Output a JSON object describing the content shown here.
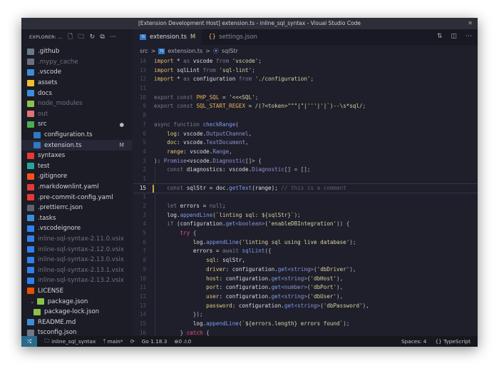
{
  "window": {
    "title": "[Extension Development Host] extension.ts - inline_sql_syntax - Visual Studio Code",
    "close": "✕"
  },
  "sidebar": {
    "header": "EXPLORER: ...",
    "items": [
      {
        "label": ".github",
        "color": "#6b7a8a",
        "dim": false
      },
      {
        "label": ".mypy_cache",
        "color": "#6b7080",
        "dim": true
      },
      {
        "label": ".vscode",
        "color": "#3b8fd9",
        "dim": false
      },
      {
        "label": "assets",
        "color": "#f0c030",
        "dim": false
      },
      {
        "label": "docs",
        "color": "#3b8fd9",
        "dim": false
      },
      {
        "label": "node_modules",
        "color": "#8bc34a",
        "dim": true
      },
      {
        "label": "out",
        "color": "#e57373",
        "dim": true
      },
      {
        "label": "src",
        "color": "#4caf50",
        "dim": false,
        "badge": "●"
      },
      {
        "label": "configuration.ts",
        "color": "#3178c6",
        "dim": false,
        "indent": 1
      },
      {
        "label": "extension.ts",
        "color": "#3178c6",
        "dim": false,
        "indent": 1,
        "badge": "M",
        "selected": true
      },
      {
        "label": "syntaxes",
        "color": "#e53935",
        "dim": false
      },
      {
        "label": "test",
        "color": "#26a69a",
        "dim": false
      },
      {
        "label": ".gitignore",
        "color": "#f4511e",
        "dim": false
      },
      {
        "label": ".markdownlint.yaml",
        "color": "#e53935",
        "dim": false
      },
      {
        "label": ".pre-commit-config.yaml",
        "color": "#e53935",
        "dim": false
      },
      {
        "label": ".prettierrc.json",
        "color": "#5c6370",
        "dim": false
      },
      {
        "label": ".tasks",
        "color": "#3b8fd9",
        "dim": false
      },
      {
        "label": ".vscodeignore",
        "color": "#2f80ed",
        "dim": false
      },
      {
        "label": "inline-sql-syntax-2.11.0.vsix",
        "color": "#2f80ed",
        "dim": true
      },
      {
        "label": "inline-sql-syntax-2.12.0.vsix",
        "color": "#2f80ed",
        "dim": true
      },
      {
        "label": "inline-sql-syntax-2.13.0.vsix",
        "color": "#2f80ed",
        "dim": true
      },
      {
        "label": "inline-sql-syntax-2.13.1.vsix",
        "color": "#2f80ed",
        "dim": true
      },
      {
        "label": "inline-sql-syntax-2.13.2.vsix",
        "color": "#2f80ed",
        "dim": true
      },
      {
        "label": "LICENSE",
        "color": "#e65100",
        "dim": false
      },
      {
        "label": "package.json",
        "color": "#8bc34a",
        "dim": false,
        "indent": 1,
        "chevron": "⌄"
      },
      {
        "label": "package-lock.json",
        "color": "#8bc34a",
        "dim": false,
        "indent": 1
      },
      {
        "label": "README.md",
        "color": "#3b8fd9",
        "dim": false
      },
      {
        "label": "tsconfig.json",
        "color": "#6b7a8a",
        "dim": false
      }
    ]
  },
  "tabs": [
    {
      "label": "extension.ts",
      "badge": "M",
      "active": true
    },
    {
      "label": "settings.json",
      "active": false
    }
  ],
  "breadcrumb": [
    "src",
    ">",
    "extension.ts",
    ">",
    "sqlStr"
  ],
  "code": [
    [
      "14",
      [
        [
          "import",
          "kw"
        ],
        [
          " * ",
          "v"
        ],
        [
          "as",
          "dk"
        ],
        [
          " vscode ",
          "v"
        ],
        [
          "from",
          "dk"
        ],
        [
          " 'vscode'",
          "str"
        ],
        [
          ";",
          "p"
        ]
      ]
    ],
    [
      "13",
      [
        [
          "import",
          "kw"
        ],
        [
          " sqlLint ",
          "v"
        ],
        [
          "from",
          "dk"
        ],
        [
          " 'sql-lint'",
          "str"
        ],
        [
          ";",
          "p"
        ]
      ]
    ],
    [
      "12",
      [
        [
          "import",
          "kw"
        ],
        [
          " * ",
          "v"
        ],
        [
          "as",
          "dk"
        ],
        [
          " configuration ",
          "v"
        ],
        [
          "from",
          "dk"
        ],
        [
          " './configuration'",
          "str"
        ],
        [
          ";",
          "p"
        ]
      ]
    ],
    [
      "11",
      []
    ],
    [
      "10",
      [
        [
          "export const ",
          "dk"
        ],
        [
          "PHP_SQL",
          "cst"
        ],
        [
          " = ",
          "v"
        ],
        [
          "'<<<SQL'",
          "str"
        ],
        [
          ";",
          "p"
        ]
      ]
    ],
    [
      "9",
      [
        [
          "export const ",
          "dk"
        ],
        [
          "SQL_START_REGEX",
          "cst"
        ],
        [
          " = ",
          "v"
        ],
        [
          "/(?<token>\"\"\"|\"|'''|'|`)--\\s*sql/",
          "str"
        ],
        [
          ";",
          "p"
        ]
      ]
    ],
    [
      "8",
      []
    ],
    [
      "7",
      [
        [
          "async function ",
          "dk"
        ],
        [
          "checkRange",
          "fn"
        ],
        [
          "(",
          "p"
        ]
      ]
    ],
    [
      "6",
      [
        [
          "    log",
          "pr"
        ],
        [
          ": vscode.",
          "v"
        ],
        [
          "OutputChannel",
          "ty"
        ],
        [
          ",",
          "p"
        ]
      ]
    ],
    [
      "5",
      [
        [
          "    doc",
          "pr"
        ],
        [
          ": vscode.",
          "v"
        ],
        [
          "TextDocument",
          "ty"
        ],
        [
          ",",
          "p"
        ]
      ]
    ],
    [
      "4",
      [
        [
          "    range",
          "pr"
        ],
        [
          ": vscode.",
          "v"
        ],
        [
          "Range",
          "ty"
        ],
        [
          ",",
          "p"
        ]
      ]
    ],
    [
      "3",
      [
        [
          "): ",
          "p"
        ],
        [
          "Promise",
          "ty"
        ],
        [
          "<vscode.",
          "v"
        ],
        [
          "Diagnostic",
          "ty"
        ],
        [
          "[]> {",
          "p"
        ]
      ]
    ],
    [
      "2",
      [
        [
          "    const ",
          "dk"
        ],
        [
          "diagnostics",
          "v"
        ],
        [
          ": vscode.",
          "v"
        ],
        [
          "Diagnostic",
          "ty"
        ],
        [
          "[] = [];",
          "p"
        ]
      ]
    ],
    [
      "1",
      []
    ],
    [
      "15",
      [
        [
          "    const ",
          "dk"
        ],
        [
          "sqlStr",
          "v"
        ],
        [
          " = doc.",
          "v"
        ],
        [
          "getText",
          "fn"
        ],
        [
          "(range); ",
          "v"
        ],
        [
          "// this is a comment",
          "cm"
        ]
      ],
      "cur"
    ],
    [
      "1",
      []
    ],
    [
      "2",
      [
        [
          "    let ",
          "dk"
        ],
        [
          "errors = ",
          "v"
        ],
        [
          "null",
          "dk"
        ],
        [
          ";",
          "p"
        ]
      ]
    ],
    [
      "3",
      [
        [
          "    log.",
          "v"
        ],
        [
          "appendLine",
          "fn"
        ],
        [
          "(`linting sql: ${sqlStr}`",
          ".str"
        ],
        [
          ");",
          "p"
        ]
      ]
    ],
    [
      "4",
      [
        [
          "    if",
          "dk"
        ],
        [
          " (configuration.",
          "v"
        ],
        [
          "get",
          "fn"
        ],
        [
          "<boolean>",
          "ty"
        ],
        [
          "('enableDBIntegration'",
          "str"
        ],
        [
          ")) {",
          "p"
        ]
      ]
    ],
    [
      "5",
      [
        [
          "        try",
          "ctl"
        ],
        [
          " {",
          "p"
        ]
      ]
    ],
    [
      "6",
      [
        [
          "            log.",
          "v"
        ],
        [
          "appendLine",
          "fn"
        ],
        [
          "('linting sql using live database'",
          "str"
        ],
        [
          ");",
          "p"
        ]
      ]
    ],
    [
      "7",
      [
        [
          "            errors = ",
          "v"
        ],
        [
          "await ",
          "dk"
        ],
        [
          "sqlLint",
          "fn"
        ],
        [
          "({",
          "p"
        ]
      ]
    ],
    [
      "8",
      [
        [
          "                sql",
          "pr"
        ],
        [
          ": sqlStr,",
          "v"
        ]
      ]
    ],
    [
      "9",
      [
        [
          "                driver",
          "pr"
        ],
        [
          ": configuration.",
          "v"
        ],
        [
          "get",
          "fn"
        ],
        [
          "<string>",
          "ty"
        ],
        [
          "('dbDriver'",
          "str"
        ],
        [
          "),",
          "p"
        ]
      ]
    ],
    [
      "10",
      [
        [
          "                host",
          "pr"
        ],
        [
          ": configuration.",
          "v"
        ],
        [
          "get",
          "fn"
        ],
        [
          "<string>",
          "ty"
        ],
        [
          "('dbHost'",
          "str"
        ],
        [
          "),",
          "p"
        ]
      ]
    ],
    [
      "11",
      [
        [
          "                port",
          "pr"
        ],
        [
          ": configuration.",
          "v"
        ],
        [
          "get",
          "fn"
        ],
        [
          "<number>",
          "ty"
        ],
        [
          "('dbPort'",
          "str"
        ],
        [
          "),",
          "p"
        ]
      ]
    ],
    [
      "12",
      [
        [
          "                user",
          "pr"
        ],
        [
          ": configuration.",
          "v"
        ],
        [
          "get",
          "fn"
        ],
        [
          "<string>",
          "ty"
        ],
        [
          "('dbUser'",
          "str"
        ],
        [
          "),",
          "p"
        ]
      ]
    ],
    [
      "13",
      [
        [
          "                password",
          "pr"
        ],
        [
          ": configuration.",
          "v"
        ],
        [
          "get",
          "fn"
        ],
        [
          "<string>",
          "ty"
        ],
        [
          "('dbPassword'",
          "str"
        ],
        [
          "),",
          "p"
        ]
      ]
    ],
    [
      "14",
      [
        [
          "            });",
          "p"
        ]
      ]
    ],
    [
      "15",
      [
        [
          "            log.",
          "v"
        ],
        [
          "appendLine",
          "fn"
        ],
        [
          "(`${errors.length} errors found`",
          "str"
        ],
        [
          ");",
          "p"
        ]
      ]
    ],
    [
      "16",
      [
        [
          "        } ",
          "p"
        ],
        [
          "catch",
          "ctl"
        ],
        [
          " {",
          "p"
        ]
      ]
    ]
  ],
  "status": {
    "remote": "⤭",
    "folder": "inline_sql_syntax",
    "branch": "main*",
    "sync": "⟳",
    "go": "Go 1.18.3",
    "errors": "0",
    "warnings": "0",
    "spaces": "Spaces: 4",
    "language": "TypeScript"
  }
}
